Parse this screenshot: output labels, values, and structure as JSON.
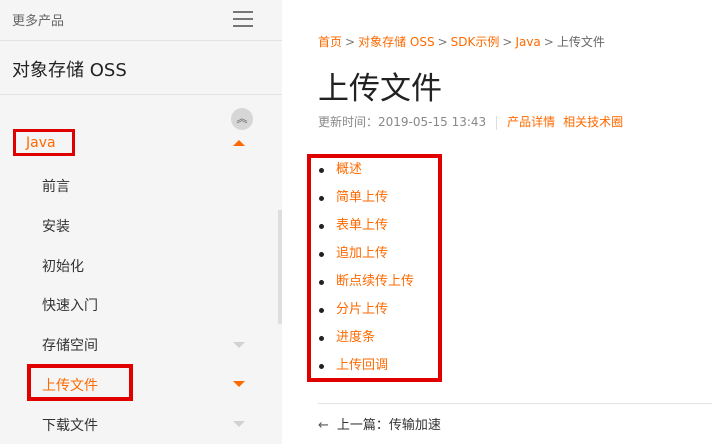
{
  "sidebar": {
    "more_products": "更多产品",
    "product_title": "对象存储 OSS",
    "active_section": "Java",
    "items": [
      {
        "label": "前言"
      },
      {
        "label": "安装"
      },
      {
        "label": "初始化"
      },
      {
        "label": "快速入门"
      },
      {
        "label": "存储空间"
      },
      {
        "label": "上传文件"
      },
      {
        "label": "下载文件"
      }
    ]
  },
  "breadcrumb": [
    "首页",
    "对象存储 OSS",
    "SDK示例",
    "Java",
    "上传文件"
  ],
  "page": {
    "title": "上传文件",
    "updated_label": "更新时间：",
    "updated_time": "2019-05-15 13:43",
    "link_product": "产品详情",
    "link_forum": "相关技术圈"
  },
  "toc": [
    "概述",
    "简单上传",
    "表单上传",
    "追加上传",
    "断点续传上传",
    "分片上传",
    "进度条",
    "上传回调"
  ],
  "nav": {
    "prev_label": "上一篇：",
    "prev_title": "传输加速"
  },
  "colors": {
    "accent": "#ff6a00",
    "highlight_box": "#e00000",
    "sidebar_bg": "#f5f5f6"
  }
}
